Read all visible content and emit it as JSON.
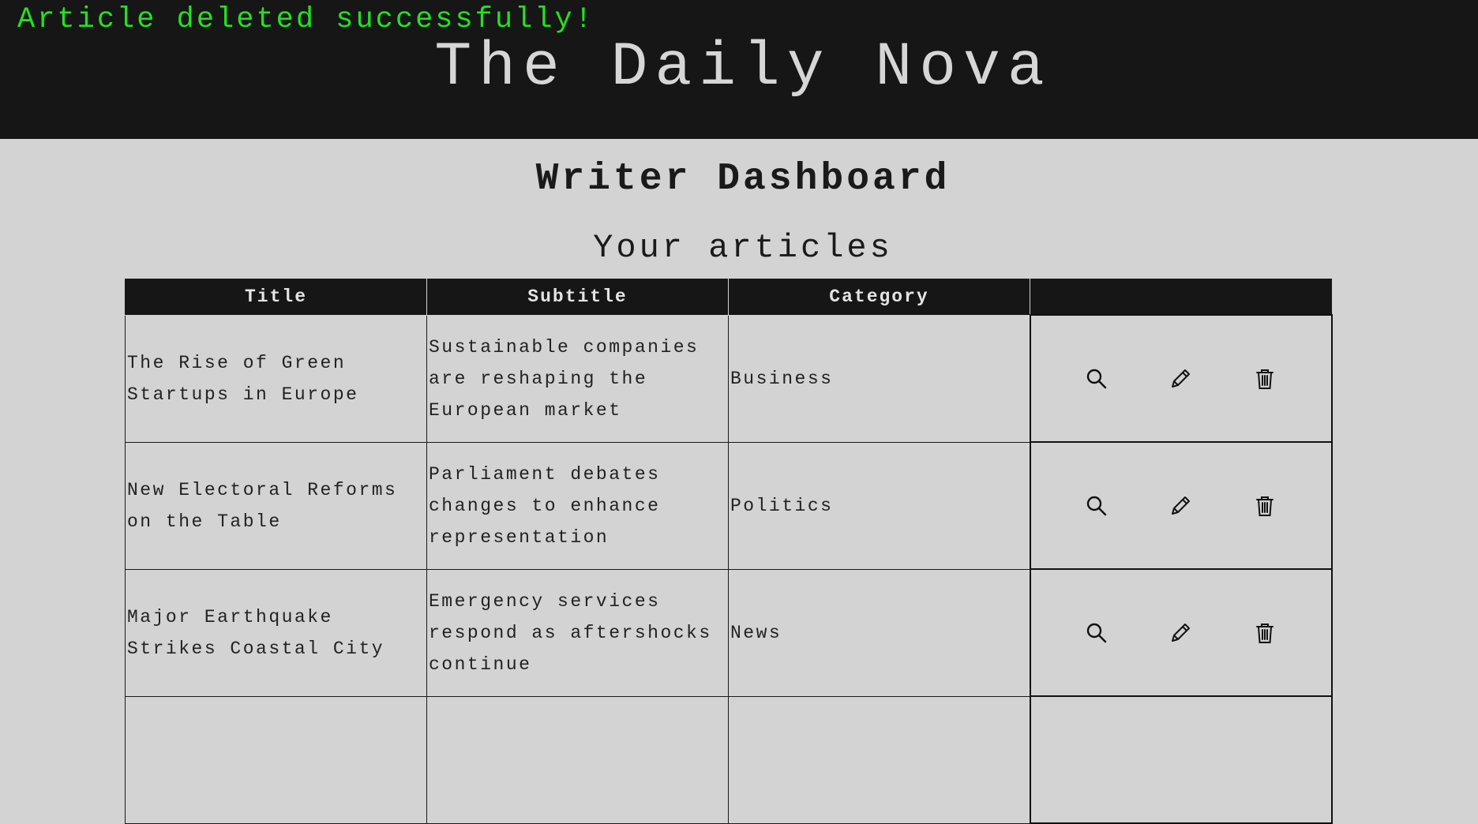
{
  "flash": {
    "message": "Article deleted successfully!",
    "color": "#22e222"
  },
  "site": {
    "title": "The Daily Nova"
  },
  "page": {
    "title": "Writer Dashboard",
    "subtitle": "Your articles"
  },
  "table": {
    "headers": {
      "title": "Title",
      "subtitle": "Subtitle",
      "category": "Category",
      "actions": ""
    },
    "rows": [
      {
        "title": "The Rise of Green Startups in Europe",
        "subtitle": "Sustainable companies are reshaping the European market",
        "category": "Business"
      },
      {
        "title": "New Electoral Reforms on the Table",
        "subtitle": "Parliament debates changes to enhance representation",
        "category": "Politics"
      },
      {
        "title": "Major Earthquake Strikes Coastal City",
        "subtitle": "Emergency services respond as aftershocks continue",
        "category": "News"
      },
      {
        "title": "",
        "subtitle": "",
        "category": ""
      }
    ],
    "row_actions": [
      "search-icon",
      "pencil-icon",
      "trash-icon"
    ]
  },
  "colors": {
    "header_bg": "#161616",
    "page_bg": "#d3d3d3",
    "header_text": "#d6d6d6"
  }
}
